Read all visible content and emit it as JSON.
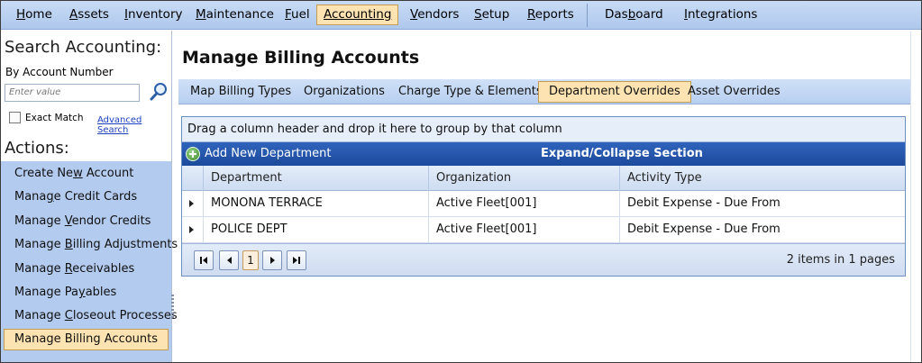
{
  "colors": {
    "accent": "#fde3b1",
    "menu": "#b8cff0",
    "command_bar": "#2456a8"
  },
  "menu": {
    "items": [
      {
        "label": "Home",
        "u": "H",
        "rest": "ome"
      },
      {
        "label": "Assets",
        "u": "A",
        "rest": "ssets"
      },
      {
        "label": "Inventory",
        "u": "I",
        "rest": "nventory"
      },
      {
        "label": "Maintenance",
        "u": "M",
        "rest": "aintenance"
      },
      {
        "label": "Fuel",
        "u": "F",
        "rest": "uel"
      },
      {
        "label": "Accounting",
        "u": "Accounting",
        "rest": ""
      },
      {
        "label": "Vendors",
        "u": "V",
        "rest": "endors"
      },
      {
        "label": "Setup",
        "u": "S",
        "rest": "etup"
      },
      {
        "label": "Reports",
        "u": "R",
        "rest": "eports"
      },
      {
        "label": "Dashboard",
        "u": "b",
        "pre": "Das",
        "rest": "oard"
      },
      {
        "label": "Integrations",
        "u": "I",
        "rest": "ntegrations"
      }
    ],
    "active": "Accounting"
  },
  "sidebar": {
    "search_title": "Search Accounting:",
    "search_by": "By Account Number",
    "search_placeholder": "Enter value",
    "exact_match": "Exact Match",
    "advanced_search": "Advanced Search",
    "actions_title": "Actions:",
    "actions": [
      {
        "pre": "Create Ne",
        "u": "w",
        "rest": " Account"
      },
      {
        "pre": "Mana",
        "u": "g",
        "rest": "e Credit Cards"
      },
      {
        "pre": "Manage ",
        "u": "V",
        "rest": "endor Credits"
      },
      {
        "pre": "Manage ",
        "u": "B",
        "rest": "illing Adjustments"
      },
      {
        "pre": "Manage ",
        "u": "R",
        "rest": "eceivables"
      },
      {
        "pre": "Manage Pa",
        "u": "y",
        "rest": "ables"
      },
      {
        "pre": "Manage ",
        "u": "C",
        "rest": "loseout Processes"
      },
      {
        "pre": "Manage Billing Accounts",
        "u": "",
        "rest": ""
      }
    ],
    "active_action": "Manage Billing Accounts"
  },
  "main": {
    "title": "Manage Billing Accounts",
    "tabs": [
      {
        "pre": "",
        "u": "",
        "rest": "Map Billing Types"
      },
      {
        "pre": "",
        "u": "",
        "rest": "Organizations"
      },
      {
        "pre": "",
        "u": "",
        "rest": "Charge Type & Elements"
      },
      {
        "pre": "",
        "u": "",
        "rest": "Department Overrides"
      },
      {
        "pre": "",
        "u": "",
        "rest": "Asset Overrides"
      }
    ],
    "active_tab": "Department Overrides",
    "grid": {
      "group_hint": "Drag a column header and drop it here to group by that column",
      "add_new": "Add New Department",
      "expand_collapse": "Expand/Collapse Section",
      "columns": [
        "Department",
        "Organization",
        "Activity Type"
      ],
      "rows": [
        [
          "MONONA TERRACE",
          "Active Fleet[001]",
          "Debit Expense - Due From"
        ],
        [
          "POLICE DEPT",
          "Active Fleet[001]",
          "Debit Expense - Due From"
        ]
      ],
      "current_page": "1",
      "pager_info": "2 items in 1 pages"
    }
  }
}
